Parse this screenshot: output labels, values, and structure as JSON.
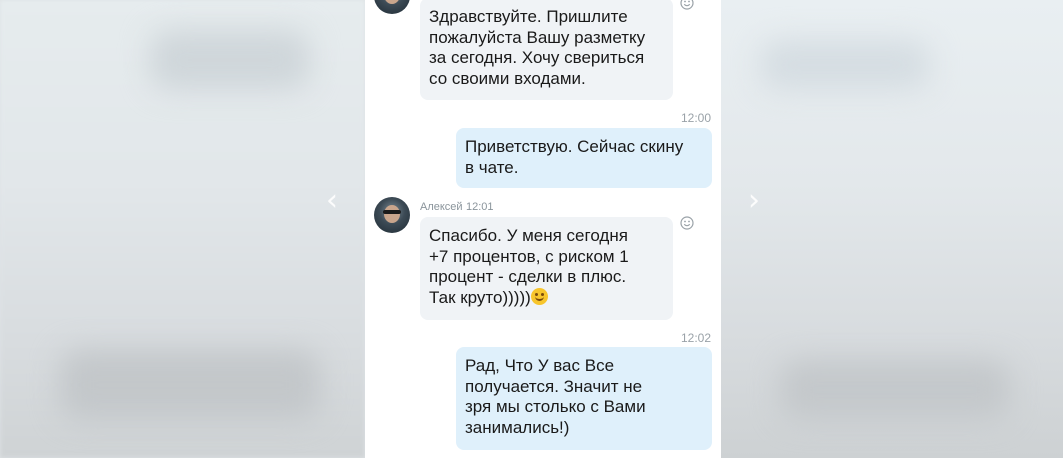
{
  "messages": [
    {
      "id": "m1",
      "direction": "incoming",
      "text": "Здравствуйте. Пришлите\nпожалуйста Вашу разметку\nза сегодня. Хочу свериться\nсо своими входами."
    },
    {
      "id": "m2",
      "direction": "outgoing",
      "time": "12:00",
      "text": "Приветствую. Сейчас скину\nв чате."
    },
    {
      "id": "m3",
      "direction": "incoming",
      "sender": "Алексей",
      "time": "12:01",
      "text": "Спасибо. У меня сегодня\n+7 процентов, с риском 1\nпроцент - сделки в плюс.\nТак круто)))))",
      "emoji": "smiling-face"
    },
    {
      "id": "m4",
      "direction": "outgoing",
      "time": "12:02",
      "text": "Рад, Что У вас Все\nполучается. Значит не\nзря мы столько с Вами\nзанимались!)"
    }
  ],
  "icons": {
    "reaction": "smile-reaction-icon",
    "prev": "chevron-left-icon",
    "next": "chevron-right-icon"
  },
  "colors": {
    "incoming_bubble": "#f0f3f6",
    "outgoing_bubble": "#dff0fb",
    "timestamp": "#9aa2a8"
  }
}
